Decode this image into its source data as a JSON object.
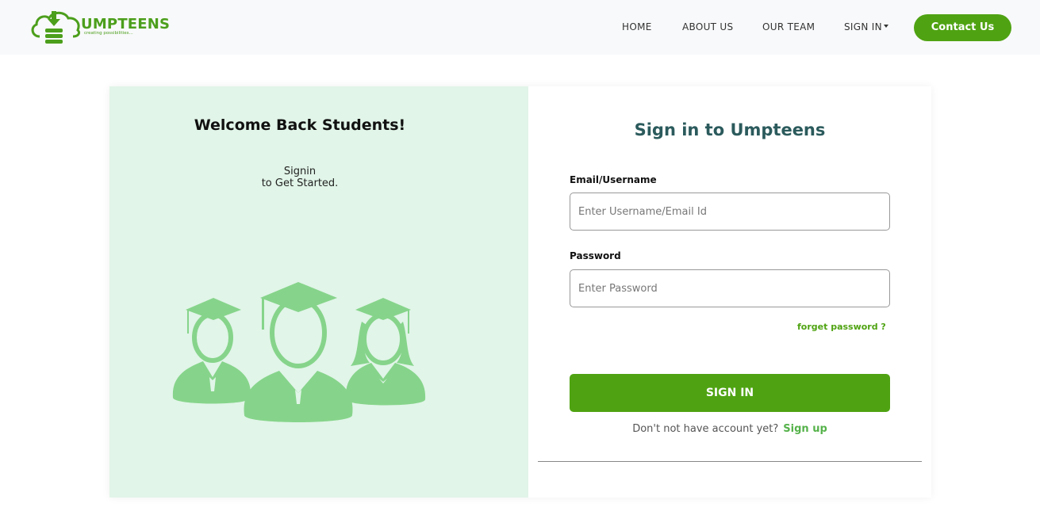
{
  "brand": {
    "name": "UMPTEENS",
    "tagline": "creating possibilities..."
  },
  "nav": {
    "home": "HOME",
    "about": "ABOUT US",
    "team": "OUR TEAM",
    "signin": "SIGN IN",
    "contact": "Contact Us"
  },
  "left": {
    "welcome": "Welcome Back Students!",
    "sub_line1": "Signin",
    "sub_line2": "to Get Started."
  },
  "form": {
    "title": "Sign in to Umpteens",
    "email_label": "Email/Username",
    "email_placeholder": "Enter Username/Email Id",
    "email_value": "",
    "password_label": "Password",
    "password_placeholder": "Enter Password",
    "password_value": "",
    "forget": "forget password ?",
    "submit": "SIGN IN",
    "no_account": "Don't not have account yet?",
    "signup": "Sign up"
  },
  "colors": {
    "brand_green": "#4fa312",
    "panel_bg": "#e1f5e8",
    "illustration_green": "#86d48b",
    "title_teal": "#2b5a5c"
  }
}
